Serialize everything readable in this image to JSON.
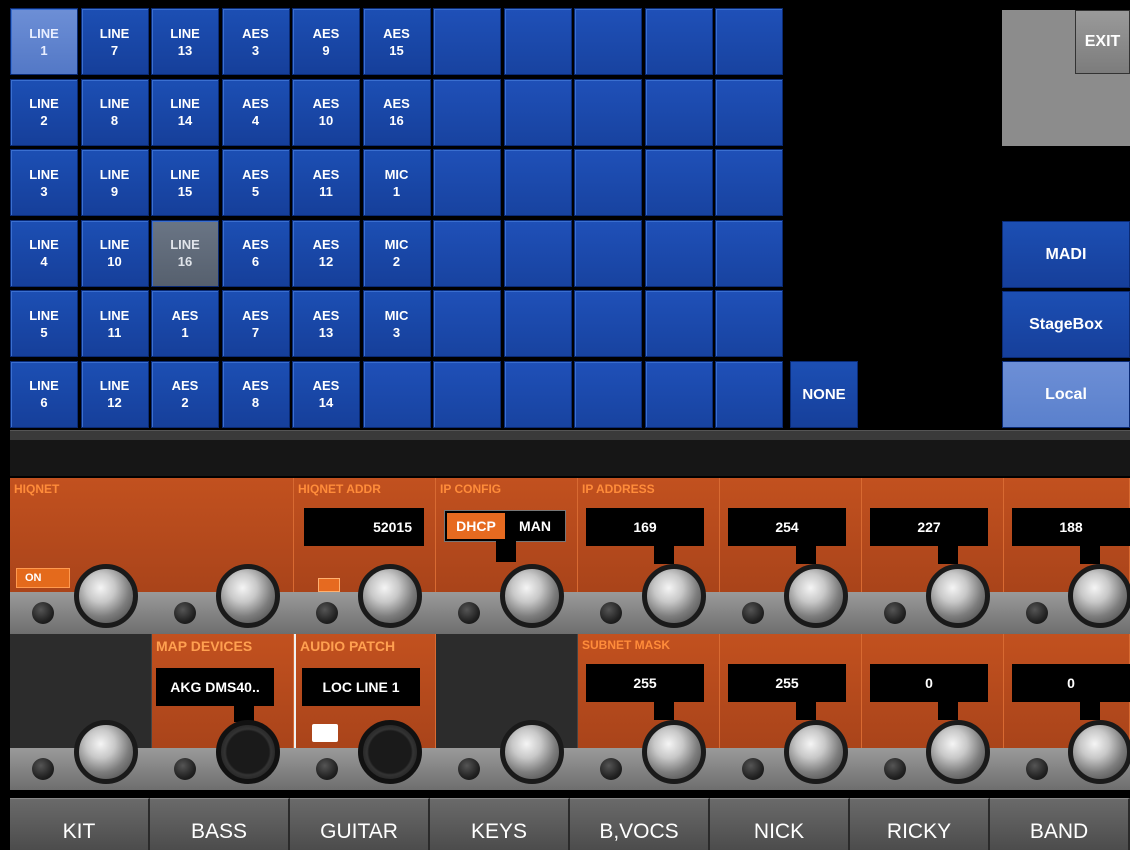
{
  "grid": {
    "columns": [
      [
        {
          "line1": "LINE",
          "line2": "1"
        },
        {
          "line1": "LINE",
          "line2": "2"
        },
        {
          "line1": "LINE",
          "line2": "3"
        },
        {
          "line1": "LINE",
          "line2": "4"
        },
        {
          "line1": "LINE",
          "line2": "5"
        },
        {
          "line1": "LINE",
          "line2": "6"
        }
      ],
      [
        {
          "line1": "LINE",
          "line2": "7"
        },
        {
          "line1": "LINE",
          "line2": "8"
        },
        {
          "line1": "LINE",
          "line2": "9"
        },
        {
          "line1": "LINE",
          "line2": "10"
        },
        {
          "line1": "LINE",
          "line2": "11"
        },
        {
          "line1": "LINE",
          "line2": "12"
        }
      ],
      [
        {
          "line1": "LINE",
          "line2": "13"
        },
        {
          "line1": "LINE",
          "line2": "14"
        },
        {
          "line1": "LINE",
          "line2": "15"
        },
        {
          "line1": "LINE",
          "line2": "16"
        },
        {
          "line1": "AES",
          "line2": "1"
        },
        {
          "line1": "AES",
          "line2": "2"
        }
      ],
      [
        {
          "line1": "AES",
          "line2": "3"
        },
        {
          "line1": "AES",
          "line2": "4"
        },
        {
          "line1": "AES",
          "line2": "5"
        },
        {
          "line1": "AES",
          "line2": "6"
        },
        {
          "line1": "AES",
          "line2": "7"
        },
        {
          "line1": "AES",
          "line2": "8"
        }
      ],
      [
        {
          "line1": "AES",
          "line2": "9"
        },
        {
          "line1": "AES",
          "line2": "10"
        },
        {
          "line1": "AES",
          "line2": "11"
        },
        {
          "line1": "AES",
          "line2": "12"
        },
        {
          "line1": "AES",
          "line2": "13"
        },
        {
          "line1": "AES",
          "line2": "14"
        }
      ],
      [
        {
          "line1": "AES",
          "line2": "15"
        },
        {
          "line1": "AES",
          "line2": "16"
        },
        {
          "line1": "MIC",
          "line2": "1"
        },
        {
          "line1": "MIC",
          "line2": "2"
        },
        {
          "line1": "MIC",
          "line2": "3"
        },
        {
          "line1": "",
          "line2": ""
        }
      ]
    ],
    "selected": "LINE 1",
    "highlighted": "LINE 16",
    "none_label": "NONE"
  },
  "exit_label": "EXIT",
  "sources": {
    "madi": "MADI",
    "stagebox": "StageBox",
    "local": "Local",
    "active": "Local"
  },
  "upper_strip": {
    "hiqnet_label": "HIQNET",
    "hiqnet_on": "ON",
    "hiqnet_addr_label": "HIQNET ADDR",
    "hiqnet_addr_value": "52015",
    "ip_config_label": "IP CONFIG",
    "ip_config_dhcp": "DHCP",
    "ip_config_man": "MAN",
    "ip_address_label": "IP ADDRESS",
    "ip_address": [
      "169",
      "254",
      "227",
      "188"
    ]
  },
  "lower_strip": {
    "map_devices_label": "MAP DEVICES",
    "map_devices_value": "AKG DMS40..",
    "audio_patch_label": "AUDIO PATCH",
    "audio_patch_value": "LOC LINE 1",
    "subnet_label": "SUBNET MASK",
    "subnet": [
      "255",
      "255",
      "0",
      "0"
    ]
  },
  "tabs": [
    "KIT",
    "BASS",
    "GUITAR",
    "KEYS",
    "B,VOCS",
    "NICK",
    "RICKY",
    "BAND"
  ],
  "colors": {
    "blue": "#1c4fb4",
    "orange": "#c2511f",
    "accent": "#e66a20",
    "selected_blue": "#6d8fd6"
  }
}
